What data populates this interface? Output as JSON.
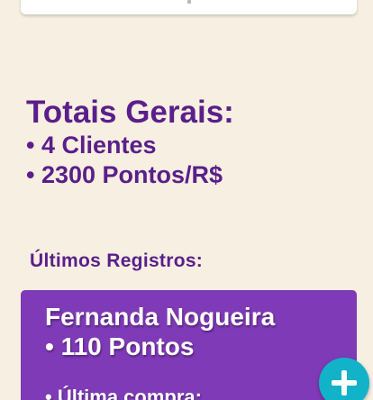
{
  "totals": {
    "heading": "Totais Gerais:",
    "clients": "• 4 Clientes",
    "points": "• 2300 Pontos/R$"
  },
  "recent": {
    "heading": "Últimos Registros:",
    "items": [
      {
        "name": "Fernanda Nogueira",
        "points": "• 110 Pontos",
        "last_purchase": "• Última compra:"
      }
    ]
  },
  "fab": {
    "icon": "plus-icon",
    "color": "#12b3c8"
  },
  "colors": {
    "background": "#f7efe1",
    "accent": "#5a1f8a",
    "card": "#7f3ab7"
  }
}
